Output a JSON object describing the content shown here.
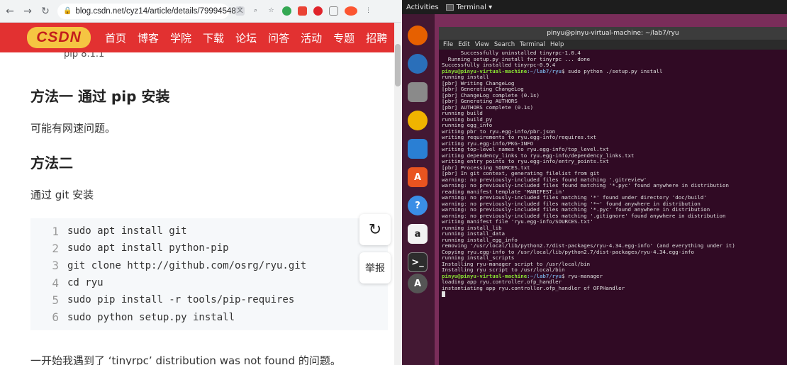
{
  "browser": {
    "url": "blog.csdn.net/cyz14/article/details/79994548",
    "nav_items": [
      "首页",
      "博客",
      "学院",
      "下载",
      "论坛",
      "问答",
      "活动",
      "专题",
      "招聘"
    ],
    "logo_text": "CSDN",
    "article": {
      "cut_line": "pip 8.1.1",
      "heading1": "方法一 通过 pip 安装",
      "para1": "可能有网速问题。",
      "heading2": "方法二",
      "para2": "通过 git 安装",
      "code_lines": [
        {
          "n": "1",
          "code": "sudo apt install git"
        },
        {
          "n": "2",
          "code": "sudo apt install python-pip"
        },
        {
          "n": "3",
          "code": "git clone http://github.com/osrg/ryu.git"
        },
        {
          "n": "4",
          "code": "cd ryu"
        },
        {
          "n": "5",
          "code": "sudo pip install -r tools/pip-requires"
        },
        {
          "n": "6",
          "code": "sudo python setup.py install"
        }
      ],
      "para3": "一开始我遇到了 ‘tinyrpc’ distribution was not found 的问题。",
      "report_label": "举报"
    }
  },
  "desktop": {
    "activities": "Activities",
    "app_menu": "Terminal ▾",
    "terminal": {
      "title": "pinyu@pinyu-virtual-machine: ~/lab7/ryu",
      "menus": [
        "File",
        "Edit",
        "View",
        "Search",
        "Terminal",
        "Help"
      ],
      "lines": [
        {
          "t": "      Successfully uninstalled tinyrpc-1.0.4"
        },
        {
          "t": "  Running setup.py install for tinyrpc ... done"
        },
        {
          "t": "Successfully installed tinyrpc-0.9.4"
        },
        {
          "user": "pinyu@pinyu-virtual-machine",
          "path": ":~/lab7/ryu",
          "t": "$ sudo python ./setup.py install"
        },
        {
          "t": "running install"
        },
        {
          "t": "[pbr] Writing ChangeLog"
        },
        {
          "t": "[pbr] Generating ChangeLog"
        },
        {
          "t": "[pbr] ChangeLog complete (0.1s)"
        },
        {
          "t": "[pbr] Generating AUTHORS"
        },
        {
          "t": "[pbr] AUTHORS complete (0.1s)"
        },
        {
          "t": "running build"
        },
        {
          "t": "running build_py"
        },
        {
          "t": "running egg_info"
        },
        {
          "t": "writing pbr to ryu.egg-info/pbr.json"
        },
        {
          "t": "writing requirements to ryu.egg-info/requires.txt"
        },
        {
          "t": "writing ryu.egg-info/PKG-INFO"
        },
        {
          "t": "writing top-level names to ryu.egg-info/top_level.txt"
        },
        {
          "t": "writing dependency_links to ryu.egg-info/dependency_links.txt"
        },
        {
          "t": "writing entry points to ryu.egg-info/entry_points.txt"
        },
        {
          "t": "[pbr] Processing SOURCES.txt"
        },
        {
          "t": "[pbr] In git context, generating filelist from git"
        },
        {
          "t": "warning: no previously-included files found matching '.gitreview'"
        },
        {
          "t": "warning: no previously-included files found matching '*.pyc' found anywhere in distribution"
        },
        {
          "t": "reading manifest template 'MANIFEST.in'"
        },
        {
          "t": "warning: no previously-included files matching '*' found under directory 'doc/build'"
        },
        {
          "t": "warning: no previously-included files matching '*~' found anywhere in distribution"
        },
        {
          "t": "warning: no previously-included files matching '*.pyc' found anywhere in distribution"
        },
        {
          "t": "warning: no previously-included files matching '.gitignore' found anywhere in distribution"
        },
        {
          "t": "writing manifest file 'ryu.egg-info/SOURCES.txt'"
        },
        {
          "t": "running install_lib"
        },
        {
          "t": "running install_data"
        },
        {
          "t": "running install_egg_info"
        },
        {
          "t": "removing '/usr/local/lib/python2.7/dist-packages/ryu-4.34.egg-info' (and everything under it)"
        },
        {
          "t": "Copying ryu.egg-info to /usr/local/lib/python2.7/dist-packages/ryu-4.34.egg-info"
        },
        {
          "t": "running install_scripts"
        },
        {
          "t": "Installing ryu-manager script to /usr/local/bin"
        },
        {
          "t": "Installing ryu script to /usr/local/bin"
        },
        {
          "user": "pinyu@pinyu-virtual-machine",
          "path": ":~/lab7/ryu",
          "t": "$ ryu-manager"
        },
        {
          "t": "loading app ryu.controller.ofp_handler"
        },
        {
          "t": "instantiating app ryu.controller.ofp_handler of OFPHandler"
        }
      ]
    },
    "dock_icons": [
      {
        "name": "firefox-icon",
        "color": "#e66000"
      },
      {
        "name": "thunderbird-icon",
        "color": "#2a6fba"
      },
      {
        "name": "files-icon",
        "color": "#8a8a8a"
      },
      {
        "name": "rhythmbox-icon",
        "color": "#f0b400"
      },
      {
        "name": "writer-icon",
        "color": "#2a7fd4"
      },
      {
        "name": "software-icon",
        "color": "#e95420"
      },
      {
        "name": "help-icon",
        "color": "#3a8ee6"
      },
      {
        "name": "amazon-icon",
        "color": "#f2f2f2"
      },
      {
        "name": "terminal-icon",
        "color": "#2d2d2d"
      },
      {
        "name": "updater-icon",
        "color": "#555555"
      }
    ]
  }
}
